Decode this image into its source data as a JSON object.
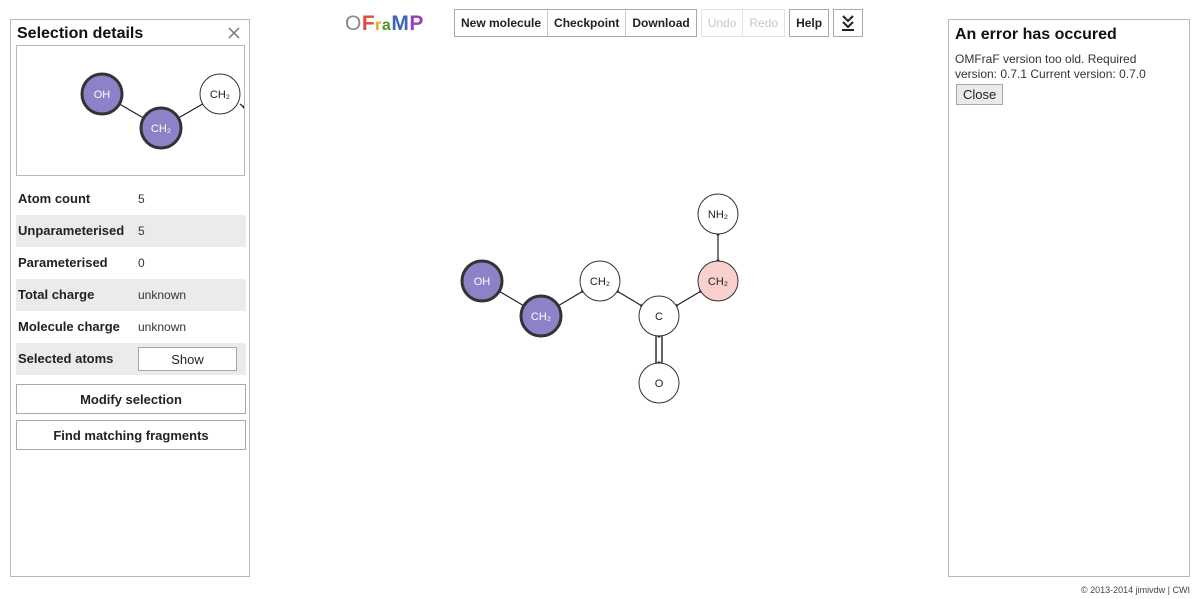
{
  "app": {
    "logo_text": "OFraMP",
    "logo_letter_colors": [
      "#8a8a8a",
      "#e24b3b",
      "#e8a21c",
      "#4c9a2a",
      "#3f63b8",
      "#9a3fb8"
    ]
  },
  "toolbar": {
    "new_molecule": "New molecule",
    "checkpoint": "Checkpoint",
    "download": "Download",
    "undo": "Undo",
    "redo": "Redo",
    "help": "Help"
  },
  "selection_panel": {
    "title": "Selection details",
    "properties": [
      {
        "label": "Atom count",
        "value": "5"
      },
      {
        "label": "Unparameterised",
        "value": "5"
      },
      {
        "label": "Parameterised",
        "value": "0"
      },
      {
        "label": "Total charge",
        "value": "unknown"
      },
      {
        "label": "Molecule charge",
        "value": "unknown"
      },
      {
        "label": "Selected atoms",
        "button": "Show"
      }
    ],
    "modify_selection": "Modify selection",
    "find_fragments": "Find matching fragments",
    "preview_atoms": [
      {
        "label": "OH",
        "state": "selected"
      },
      {
        "label": "CH₂",
        "state": "selected"
      },
      {
        "label": "CH₂",
        "state": "normal"
      }
    ]
  },
  "molecule": {
    "atoms": [
      {
        "id": "oh",
        "label": "OH",
        "state": "selected"
      },
      {
        "id": "ch2a",
        "label": "CH₂",
        "state": "selected"
      },
      {
        "id": "ch2b",
        "label": "CH₂",
        "state": "normal"
      },
      {
        "id": "c",
        "label": "C",
        "state": "normal"
      },
      {
        "id": "o",
        "label": "O",
        "state": "normal"
      },
      {
        "id": "ch2c",
        "label": "CH₂",
        "state": "highlighted"
      },
      {
        "id": "nh2",
        "label": "NH₂",
        "state": "normal"
      }
    ],
    "bonds": [
      {
        "from": "oh",
        "to": "ch2a",
        "order": 1
      },
      {
        "from": "ch2a",
        "to": "ch2b",
        "order": 1
      },
      {
        "from": "ch2b",
        "to": "c",
        "order": 1
      },
      {
        "from": "c",
        "to": "o",
        "order": 2
      },
      {
        "from": "c",
        "to": "ch2c",
        "order": 1
      },
      {
        "from": "ch2c",
        "to": "nh2",
        "order": 1
      }
    ],
    "colors": {
      "selected_fill": "#8b82c8",
      "highlighted_fill": "#f9d0cc",
      "normal_fill": "#ffffff"
    }
  },
  "error_panel": {
    "title": "An error has occured",
    "message": "OMFraF version too old. Required version: 0.7.1 Current version: 0.7.0",
    "close_label": "Close"
  },
  "footer": {
    "text": "© 2013-2014 jimivdw | CWI"
  }
}
